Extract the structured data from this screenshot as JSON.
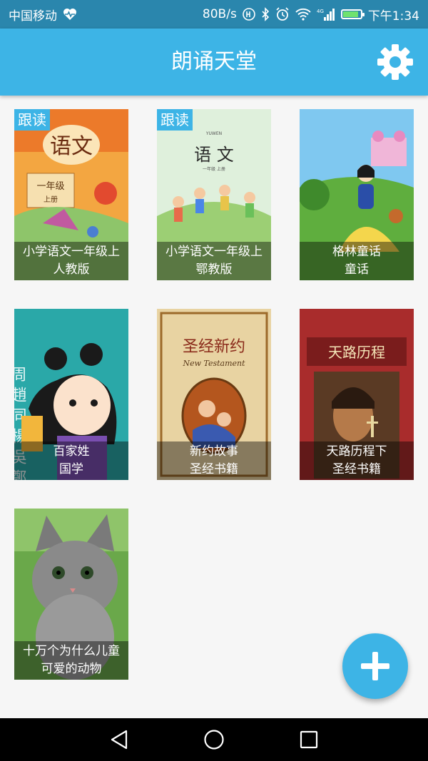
{
  "status_bar": {
    "carrier": "中国移动",
    "speed": "80B/s",
    "network_type": "4G",
    "time": "下午1:34"
  },
  "app_bar": {
    "title": "朗诵天堂",
    "settings_icon": "gear-icon"
  },
  "books": [
    {
      "tag": "跟读",
      "line1": "小学语文一年级上",
      "line2": "人教版"
    },
    {
      "tag": "跟读",
      "line1": "小学语文一年级上",
      "line2": "鄂教版"
    },
    {
      "tag": "",
      "line1": "格林童话",
      "line2": "童话"
    },
    {
      "tag": "",
      "line1": "百家姓",
      "line2": "国学"
    },
    {
      "tag": "",
      "line1": "新约故事",
      "line2": "圣经书籍"
    },
    {
      "tag": "",
      "line1": "天路历程下",
      "line2": "圣经书籍"
    },
    {
      "tag": "",
      "line1": "十万个为什么儿童",
      "line2": "可爱的动物"
    }
  ],
  "cover_texts": {
    "yuwen_cover_title": "语文",
    "yuwen_cover_grade": "一年级",
    "yuwen_cover_volume": "上册",
    "yuwen2_cover_title": "语 文",
    "yuwen2_cover_en": "YUWEN",
    "yuwen2_cover_grade": "一年级  上册",
    "baijiaxing_cover_chars": "周 趙 同 楊 吳 鄭",
    "bible_cover_title": "圣经新约",
    "bible_cover_en": "New Testament",
    "pilgrim_cover_title": "天路历程"
  },
  "fab": {
    "icon": "plus-icon"
  },
  "nav": {
    "back_icon": "back-triangle-icon",
    "home_icon": "home-circle-icon",
    "recent_icon": "recent-square-icon"
  }
}
